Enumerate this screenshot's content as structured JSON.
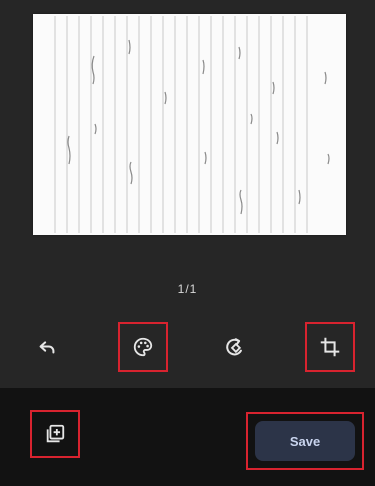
{
  "preview": {
    "page_indicator": "1/1"
  },
  "toolbar": {
    "tools": [
      {
        "name": "undo",
        "icon": "undo-icon",
        "highlighted": false
      },
      {
        "name": "filter",
        "icon": "palette-icon",
        "highlighted": true
      },
      {
        "name": "rotate",
        "icon": "rotate-icon",
        "highlighted": false
      },
      {
        "name": "crop",
        "icon": "crop-icon",
        "highlighted": true
      }
    ]
  },
  "bottom_bar": {
    "add_page_icon": "add-page-icon",
    "save_label": "Save"
  },
  "colors": {
    "background": "#1e1e1e",
    "bottom_bar": "#121212",
    "highlight_border": "#d8232f",
    "save_button_bg": "#2c3448",
    "save_button_text": "#c9d4ee",
    "icon_color": "#e6e6e6"
  }
}
